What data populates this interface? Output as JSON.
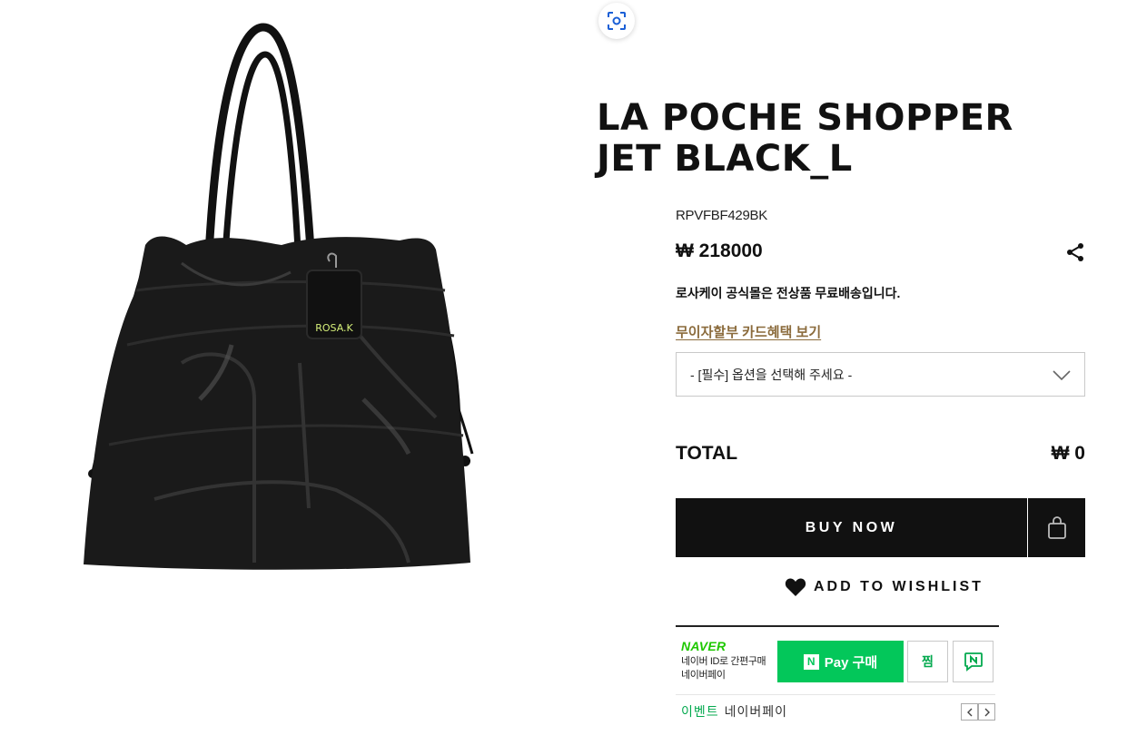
{
  "product": {
    "title_line1": "LA POCHE SHOPPER",
    "title_line2": "JET BLACK_L",
    "code": "RPVFBF429BK",
    "price": "₩ 218000",
    "shipping_notice": "로사케이 공식몰은 전상품 무료배송입니다.",
    "card_benefit_link": "무이자할부 카드혜택 보기",
    "brand_tag": "ROSA.K"
  },
  "option_select": {
    "placeholder": "- [필수] 옵션을 선택해 주세요 -"
  },
  "total": {
    "label": "TOTAL",
    "value": "₩ 0"
  },
  "actions": {
    "buy_now": "BUY NOW",
    "add_to_wishlist": "ADD TO WISHLIST"
  },
  "naver_pay": {
    "logo": "NAVER",
    "desc_line1": "네이버 ID로 간편구매",
    "desc_line2": "네이버페이",
    "n_badge": "N",
    "buy_label": "Pay 구매",
    "zzim_label": "찜",
    "event_label": "이벤트",
    "event_text": "네이버페이"
  },
  "icons": {
    "scan": "scan-icon",
    "share": "share-icon",
    "chevron": "chevron-down-icon",
    "cart": "shopping-bag-icon",
    "heart": "heart-icon",
    "talk": "naver-talk-icon"
  },
  "colors": {
    "primary": "#111111",
    "accent_gold": "#8b6b3c",
    "naver_green": "#03c75a"
  }
}
